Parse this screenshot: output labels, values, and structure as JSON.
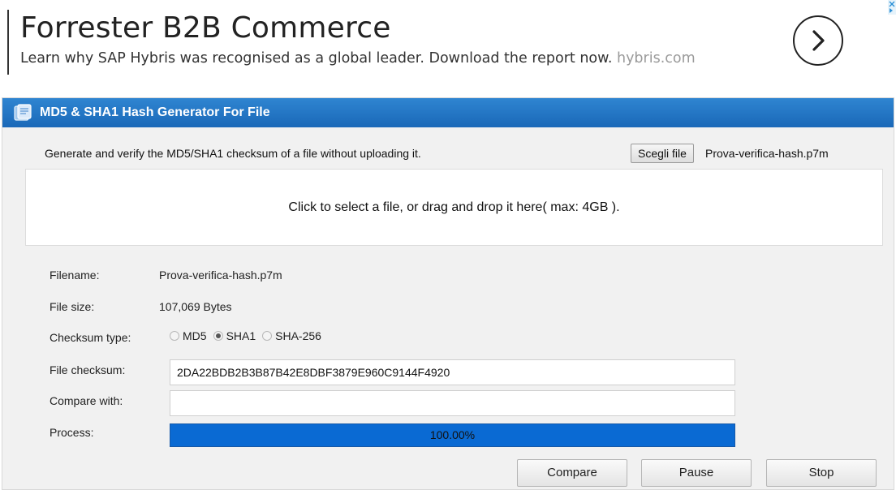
{
  "ad": {
    "title": "Forrester B2B Commerce",
    "description": "Learn why SAP Hybris was recognised as a global leader. Download the report now.",
    "domain": "hybris.com"
  },
  "panel": {
    "title": "MD5 & SHA1 Hash Generator For File",
    "intro": "Generate and verify the MD5/SHA1 checksum of a file without uploading it.",
    "file_button": "Scegli file",
    "selected_file": "Prova-verifica-hash.p7m",
    "dropzone_text": "Click to select a file, or drag and drop it here( max: 4GB ).",
    "filename_label": "Filename:",
    "filename_value": "Prova-verifica-hash.p7m",
    "filesize_label": "File size:",
    "filesize_value": "107,069 Bytes",
    "checksum_type_label": "Checksum type:",
    "checksum_types": [
      {
        "label": "MD5",
        "selected": false
      },
      {
        "label": "SHA1",
        "selected": true
      },
      {
        "label": "SHA-256",
        "selected": false
      }
    ],
    "file_checksum_label": "File checksum:",
    "file_checksum_value": "2DA22BDB2B3B87B42E8DBF3879E960C9144F4920",
    "compare_label": "Compare with:",
    "compare_value": "",
    "process_label": "Process:",
    "progress": 1.0,
    "progress_text": "100.00%",
    "buttons": {
      "compare": "Compare",
      "pause": "Pause",
      "stop": "Stop"
    }
  },
  "colors": {
    "header": "#1f73c6",
    "progress_fill": "#0a6ad3",
    "panel_bg": "#f1f1f1"
  },
  "icons": {
    "ad_arrow": "chevron-right-icon",
    "header": "file-icon",
    "ad_choices": "adchoices-icon"
  }
}
